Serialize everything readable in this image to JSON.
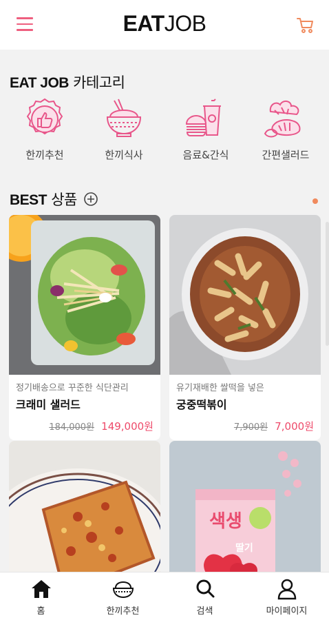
{
  "header": {
    "logo_bold": "EAT",
    "logo_light": "JOB"
  },
  "colors": {
    "accent": "#ee5f7f",
    "price": "#ee4a6a",
    "orange_dot": "#f08a5d"
  },
  "categories_section": {
    "title_strong": "EAT JOB",
    "title_rest": " 카테고리",
    "items": [
      {
        "label": "한끼추천",
        "icon": "thumbs-up-badge-icon"
      },
      {
        "label": "한끼식사",
        "icon": "rice-bowl-icon"
      },
      {
        "label": "음료&간식",
        "icon": "drink-burger-icon"
      },
      {
        "label": "간편샐러드",
        "icon": "salad-vegetables-icon"
      }
    ]
  },
  "best_section": {
    "title_strong": "BEST",
    "title_rest": " 상품",
    "products": [
      {
        "subtitle": "정기배송으로 꾸준한 식단관리",
        "name": "크래미 샐러드",
        "old_price": "184,000원",
        "new_price": "149,000원"
      },
      {
        "subtitle": "유기재배한 쌀떡을 넣은",
        "name": "궁중떡볶이",
        "old_price": "7,900원",
        "new_price": "7,000원"
      },
      {
        "subtitle": "",
        "name": "",
        "old_price": "",
        "new_price": ""
      },
      {
        "subtitle": "",
        "name": "",
        "old_price": "",
        "new_price": "",
        "pack_text": "색생",
        "pack_sub": "딸기"
      }
    ]
  },
  "bottom_nav": [
    {
      "label": "홈",
      "icon": "home-icon"
    },
    {
      "label": "한끼추천",
      "icon": "rice-bowl-icon"
    },
    {
      "label": "검색",
      "icon": "search-icon"
    },
    {
      "label": "마이페이지",
      "icon": "user-icon"
    }
  ]
}
